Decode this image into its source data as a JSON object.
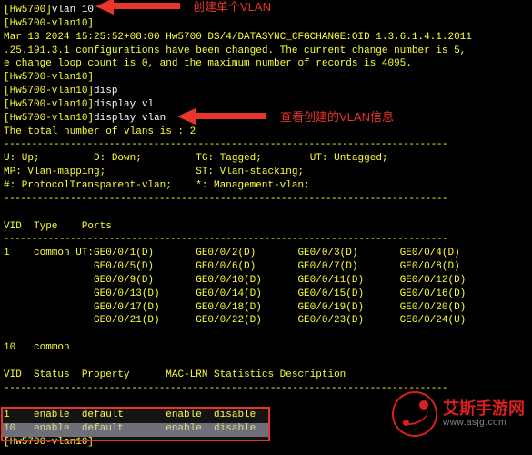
{
  "prompt1": "[Hw5700]",
  "cmd1": "vlan 10",
  "prompt2": "[Hw5700-vlan10]",
  "log_line1": "Mar 13 2024 15:25:52+08:00 Hw5700 DS/4/DATASYNC_CFGCHANGE:OID 1.3.6.1.4.1.2011",
  "log_line2": ".25.191.3.1 configurations have been changed. The current change number is 5,",
  "log_line3": "e change loop count is 0, and the maximum number of records is 4095.",
  "cmd2": "disp",
  "cmd3": "display vl",
  "cmd4": "display vlan",
  "total_line": "The total number of vlans is : 2",
  "dash": "--------------------------------------------------------------------------------",
  "legend_u": "U: Up;",
  "legend_d": "D: Down;",
  "legend_tg": "TG: Tagged;",
  "legend_ut": "UT: Untagged;",
  "legend_mp": "MP: Vlan-mapping;",
  "legend_st": "ST: Vlan-stacking;",
  "legend_hash": "#: ProtocolTransparent-vlan;",
  "legend_star": "*: Management-vlan;",
  "hdr_vid": "VID",
  "hdr_type": "Type",
  "hdr_ports": "Ports",
  "vlan1_id": "1",
  "vlan1_type": "common",
  "port_prefix": "UT:",
  "ports": [
    [
      "GE0/0/1(D)",
      "GE0/0/2(D)",
      "GE0/0/3(D)",
      "GE0/0/4(D)"
    ],
    [
      "GE0/0/5(D)",
      "GE0/0/6(D)",
      "GE0/0/7(D)",
      "GE0/0/8(D)"
    ],
    [
      "GE0/0/9(D)",
      "GE0/0/10(D)",
      "GE0/0/11(D)",
      "GE0/0/12(D)"
    ],
    [
      "GE0/0/13(D)",
      "GE0/0/14(D)",
      "GE0/0/15(D)",
      "GE0/0/16(D)"
    ],
    [
      "GE0/0/17(D)",
      "GE0/0/18(D)",
      "GE0/0/19(D)",
      "GE0/0/20(D)"
    ],
    [
      "GE0/0/21(D)",
      "GE0/0/22(D)",
      "GE0/0/23(D)",
      "GE0/0/24(U)"
    ]
  ],
  "vlan10_id": "10",
  "vlan10_type": "common",
  "hdr2_vid": "VID",
  "hdr2_status": "Status",
  "hdr2_property": "Property",
  "hdr2_maclrn": "MAC-LRN Statistics Description",
  "status_rows": [
    {
      "vid": "1",
      "status": "enable",
      "property": "default",
      "maclrn": "enable",
      "stats": "disable"
    },
    {
      "vid": "10",
      "status": "enable",
      "property": "default",
      "maclrn": "enable",
      "stats": "disable"
    }
  ],
  "final_prompt": "[Hw5700-vlan10]",
  "annotation1": "创建单个VLAN",
  "annotation2": "查看创建的VLAN信息",
  "watermark_cn": "艾斯手游网",
  "watermark_url": "www.asjg.com"
}
